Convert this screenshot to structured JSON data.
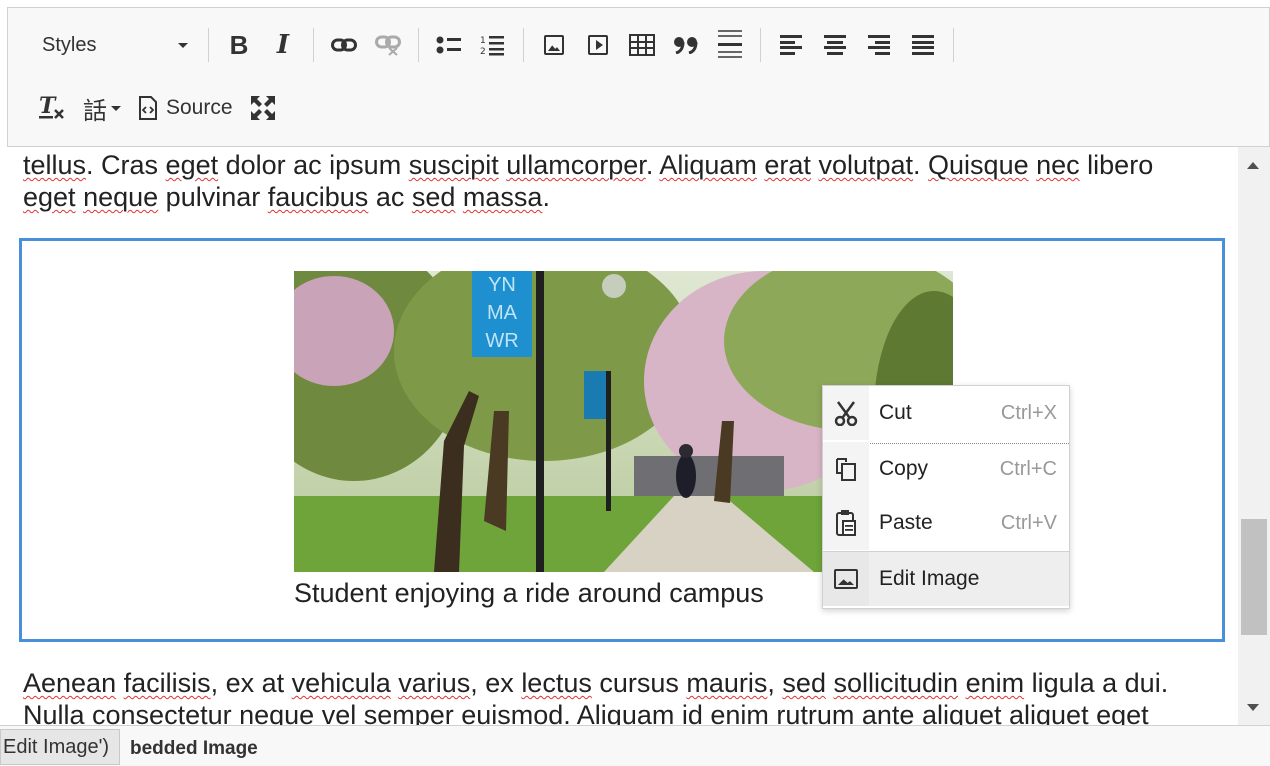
{
  "toolbar": {
    "styles_label": "Styles",
    "bold_label": "B",
    "italic_label": "I",
    "source_label": "Source",
    "language_label": "話"
  },
  "content": {
    "para1_line1": [
      "tellus",
      ". Cras ",
      "eget",
      " dolor ac ipsum ",
      "suscipit",
      " ",
      "ullamcorper",
      ". ",
      "Aliquam",
      " ",
      "erat",
      " ",
      "volutpat",
      ". ",
      "Quisque",
      " ",
      "nec",
      " libero"
    ],
    "para1_line2": [
      "eget",
      " ",
      "neque",
      " pulvinar ",
      "faucibus",
      " ac ",
      "sed",
      " ",
      "massa",
      "."
    ],
    "image_caption": "Student enjoying a ride around campus",
    "banner_text": "YN MA WR",
    "para2_line1": [
      "Aenean",
      " ",
      "facilisis",
      ", ex at ",
      "vehicula",
      " ",
      "varius",
      ", ex ",
      "lectus",
      " cursus ",
      "mauris",
      ", ",
      "sed",
      " ",
      "sollicitudin",
      " ",
      "enim",
      " ligula a dui."
    ],
    "para2_line2": "Nulla consectetur neque vel semper euismod. Aliquam id enim rutrum ante aliquet aliquet eget"
  },
  "context_menu": {
    "items": [
      {
        "label": "Cut",
        "shortcut": "Ctrl+X",
        "icon": "scissors-icon"
      },
      {
        "label": "Copy",
        "shortcut": "Ctrl+C",
        "icon": "copy-icon"
      },
      {
        "label": "Paste",
        "shortcut": "Ctrl+V",
        "icon": "paste-icon"
      },
      {
        "label": "Edit Image",
        "shortcut": "",
        "icon": "image-icon"
      }
    ]
  },
  "statusbar": {
    "path": "bedded Image",
    "tooltip": "Edit Image')"
  },
  "colors": {
    "focus_border": "#4a90d9",
    "spellcheck": "#dd3333"
  }
}
